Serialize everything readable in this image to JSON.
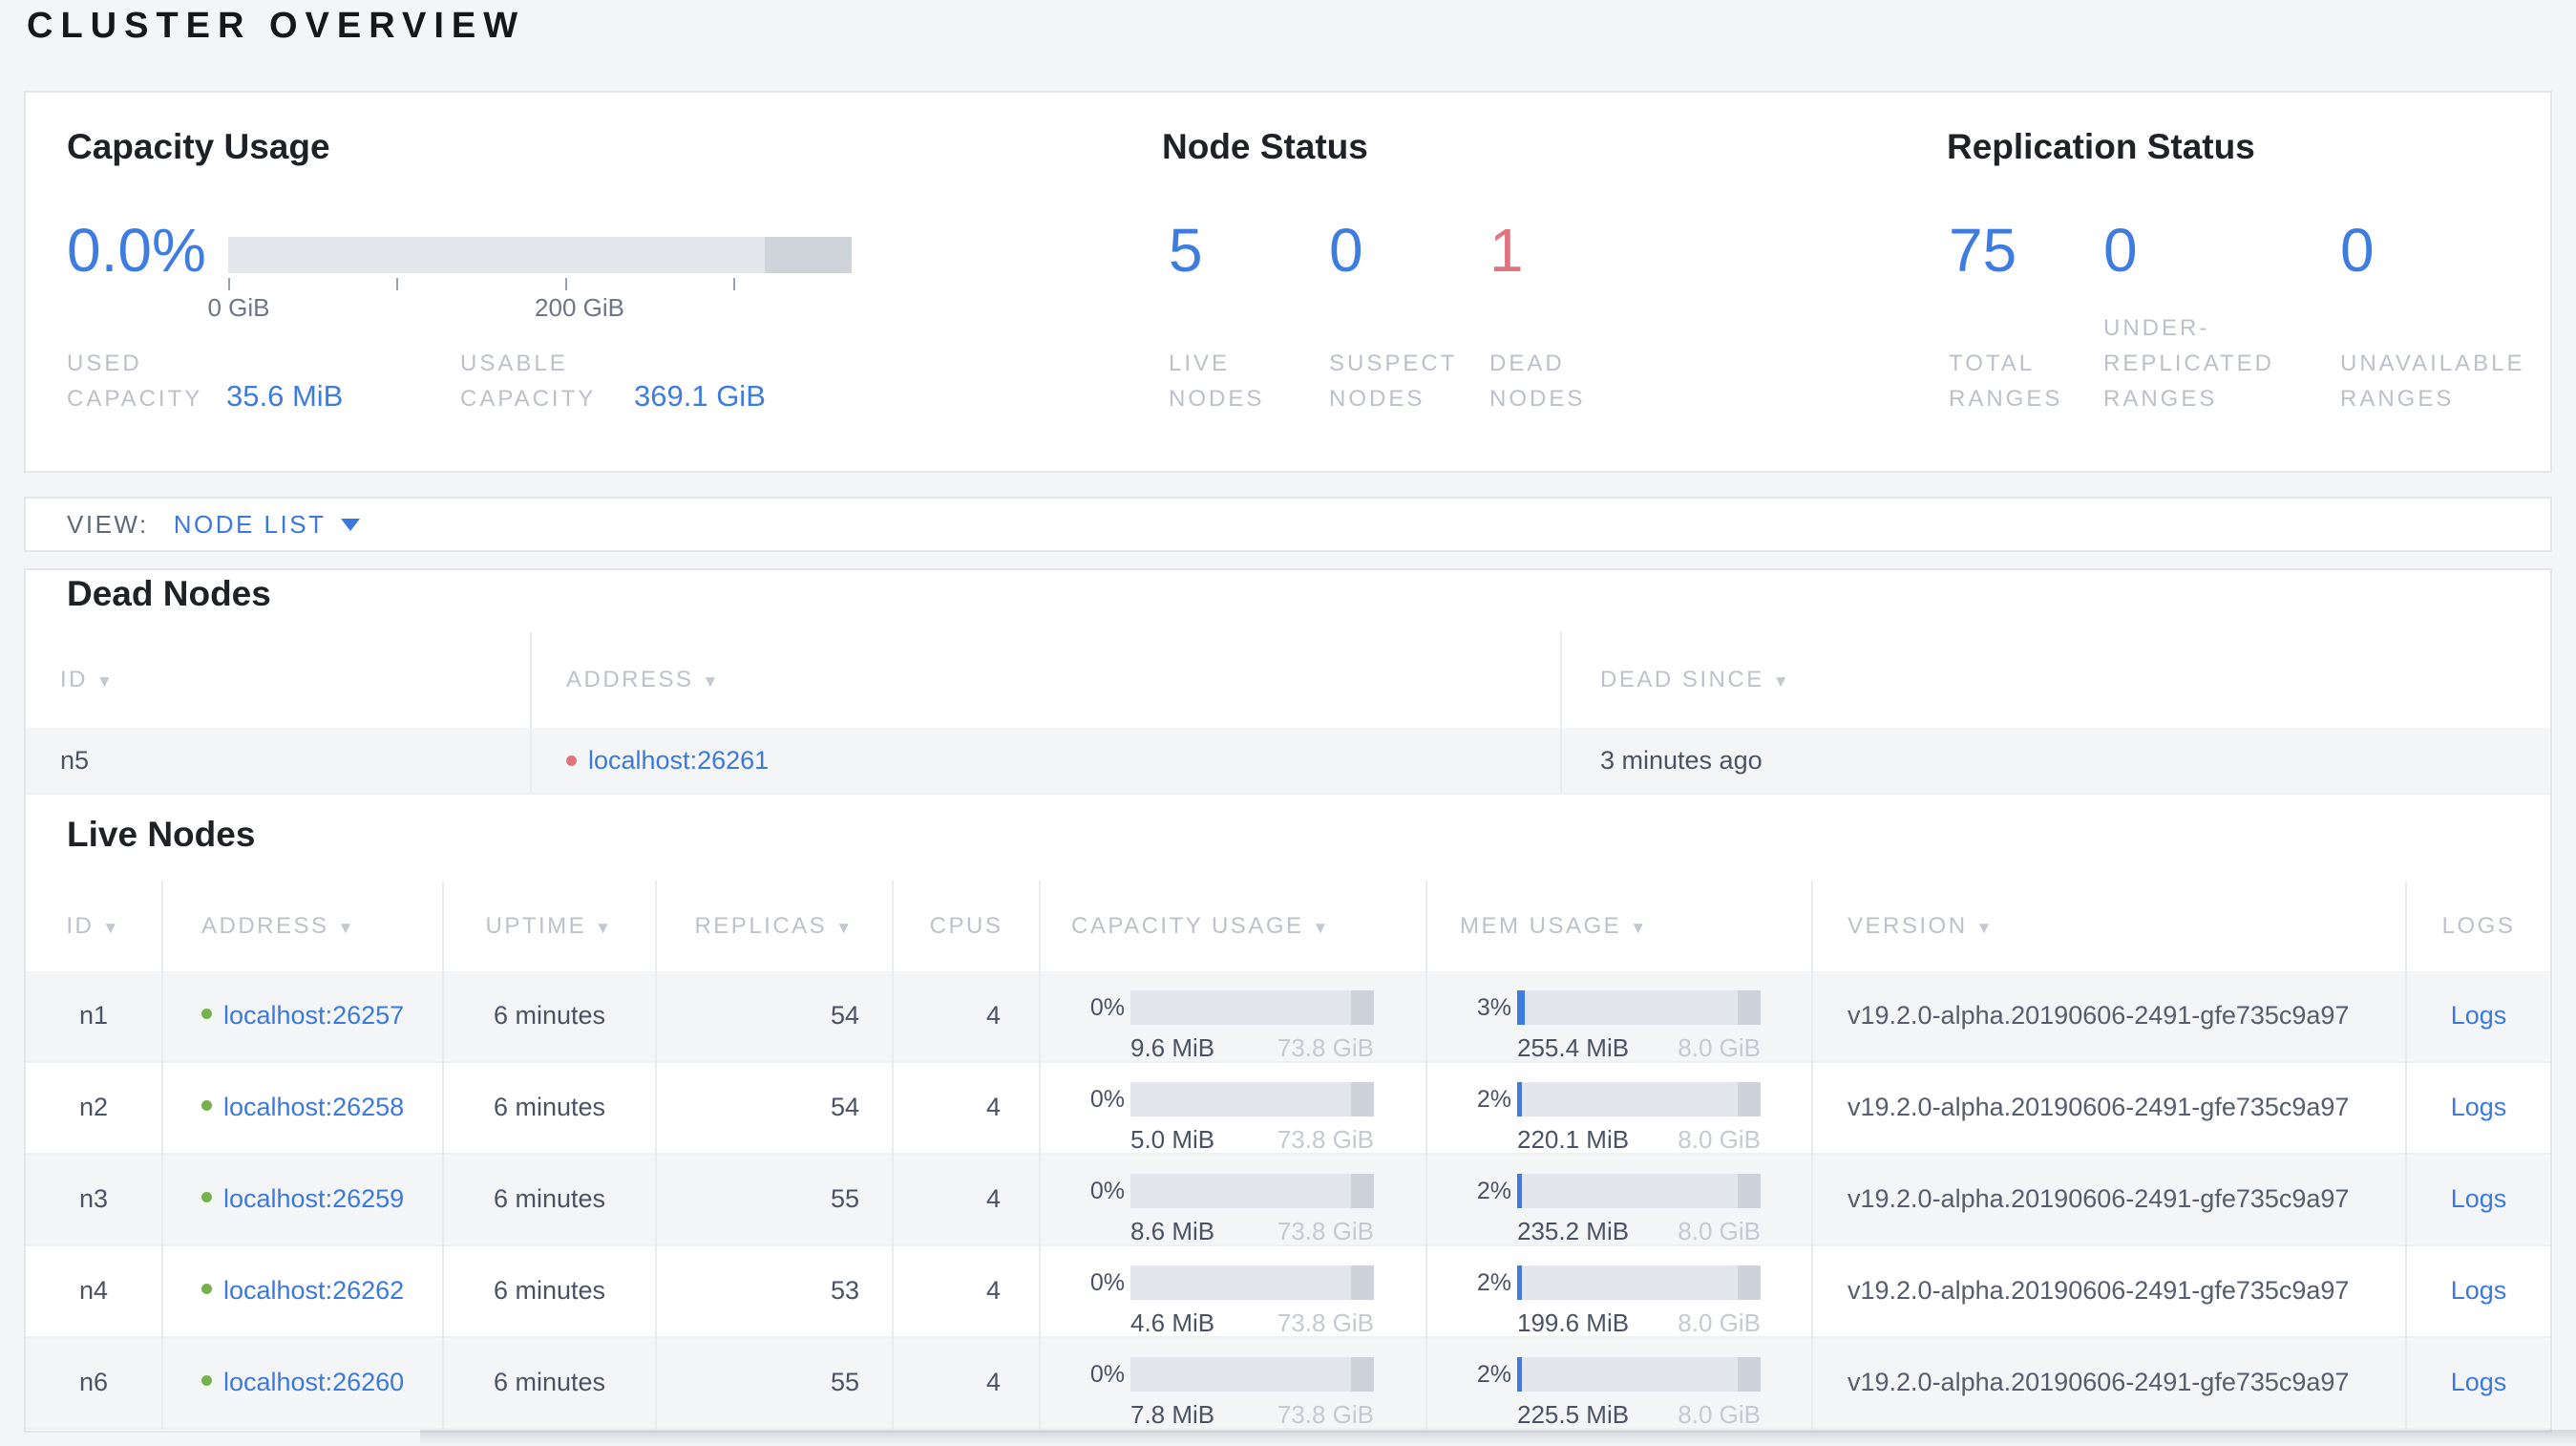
{
  "page": {
    "title": "CLUSTER OVERVIEW"
  },
  "colors": {
    "accent_blue": "#3e7ce0",
    "link_blue": "#3b79dd",
    "dead_red": "#df737e",
    "live_green": "#77b14e"
  },
  "summary": {
    "capacity": {
      "title": "Capacity Usage",
      "percent": "0.0%",
      "tick_labels": [
        "0 GiB",
        "200 GiB"
      ],
      "used_label_lines": [
        "USED",
        "CAPACITY"
      ],
      "used_value": "35.6 MiB",
      "usable_label_lines": [
        "USABLE",
        "CAPACITY"
      ],
      "usable_value": "369.1 GiB"
    },
    "node_status": {
      "title": "Node Status",
      "stats": [
        {
          "value": "5",
          "label_lines": [
            "LIVE",
            "NODES"
          ]
        },
        {
          "value": "0",
          "label_lines": [
            "SUSPECT",
            "NODES"
          ]
        },
        {
          "value": "1",
          "label_lines": [
            "DEAD",
            "NODES"
          ]
        }
      ]
    },
    "replication": {
      "title": "Replication Status",
      "stats": [
        {
          "value": "75",
          "label_lines": [
            "TOTAL",
            "RANGES"
          ]
        },
        {
          "value": "0",
          "label_lines": [
            "UNDER-",
            "REPLICATED",
            "RANGES"
          ]
        },
        {
          "value": "0",
          "label_lines": [
            "UNAVAILABLE",
            "RANGES"
          ]
        }
      ]
    }
  },
  "view_bar": {
    "label": "VIEW:",
    "selected": "NODE LIST"
  },
  "dead_nodes": {
    "heading": "Dead Nodes",
    "columns": [
      {
        "label": "ID"
      },
      {
        "label": "ADDRESS"
      },
      {
        "label": "DEAD SINCE"
      }
    ],
    "rows": [
      {
        "id": "n5",
        "address": "localhost:26261",
        "dead_since": "3 minutes ago"
      }
    ]
  },
  "live_nodes": {
    "heading": "Live Nodes",
    "columns": [
      {
        "label": "ID"
      },
      {
        "label": "ADDRESS"
      },
      {
        "label": "UPTIME"
      },
      {
        "label": "REPLICAS"
      },
      {
        "label": "CPUS"
      },
      {
        "label": "CAPACITY USAGE"
      },
      {
        "label": "MEM USAGE"
      },
      {
        "label": "VERSION"
      },
      {
        "label": "LOGS"
      }
    ],
    "rows": [
      {
        "id": "n1",
        "address": "localhost:26257",
        "uptime": "6 minutes",
        "replicas": "54",
        "cpus": "4",
        "capacity": {
          "pct": "0%",
          "fill": "0%",
          "used": "9.6 MiB",
          "total": "73.8 GiB"
        },
        "mem": {
          "pct": "3%",
          "fill": "3%",
          "used": "255.4 MiB",
          "total": "8.0 GiB"
        },
        "version": "v19.2.0-alpha.20190606-2491-gfe735c9a97",
        "logs_label": "Logs"
      },
      {
        "id": "n2",
        "address": "localhost:26258",
        "uptime": "6 minutes",
        "replicas": "54",
        "cpus": "4",
        "capacity": {
          "pct": "0%",
          "fill": "0%",
          "used": "5.0 MiB",
          "total": "73.8 GiB"
        },
        "mem": {
          "pct": "2%",
          "fill": "2%",
          "used": "220.1 MiB",
          "total": "8.0 GiB"
        },
        "version": "v19.2.0-alpha.20190606-2491-gfe735c9a97",
        "logs_label": "Logs"
      },
      {
        "id": "n3",
        "address": "localhost:26259",
        "uptime": "6 minutes",
        "replicas": "55",
        "cpus": "4",
        "capacity": {
          "pct": "0%",
          "fill": "0%",
          "used": "8.6 MiB",
          "total": "73.8 GiB"
        },
        "mem": {
          "pct": "2%",
          "fill": "2%",
          "used": "235.2 MiB",
          "total": "8.0 GiB"
        },
        "version": "v19.2.0-alpha.20190606-2491-gfe735c9a97",
        "logs_label": "Logs"
      },
      {
        "id": "n4",
        "address": "localhost:26262",
        "uptime": "6 minutes",
        "replicas": "53",
        "cpus": "4",
        "capacity": {
          "pct": "0%",
          "fill": "0%",
          "used": "4.6 MiB",
          "total": "73.8 GiB"
        },
        "mem": {
          "pct": "2%",
          "fill": "2%",
          "used": "199.6 MiB",
          "total": "8.0 GiB"
        },
        "version": "v19.2.0-alpha.20190606-2491-gfe735c9a97",
        "logs_label": "Logs"
      },
      {
        "id": "n6",
        "address": "localhost:26260",
        "uptime": "6 minutes",
        "replicas": "55",
        "cpus": "4",
        "capacity": {
          "pct": "0%",
          "fill": "0%",
          "used": "7.8 MiB",
          "total": "73.8 GiB"
        },
        "mem": {
          "pct": "2%",
          "fill": "2%",
          "used": "225.5 MiB",
          "total": "8.0 GiB"
        },
        "version": "v19.2.0-alpha.20190606-2491-gfe735c9a97",
        "logs_label": "Logs"
      }
    ]
  }
}
